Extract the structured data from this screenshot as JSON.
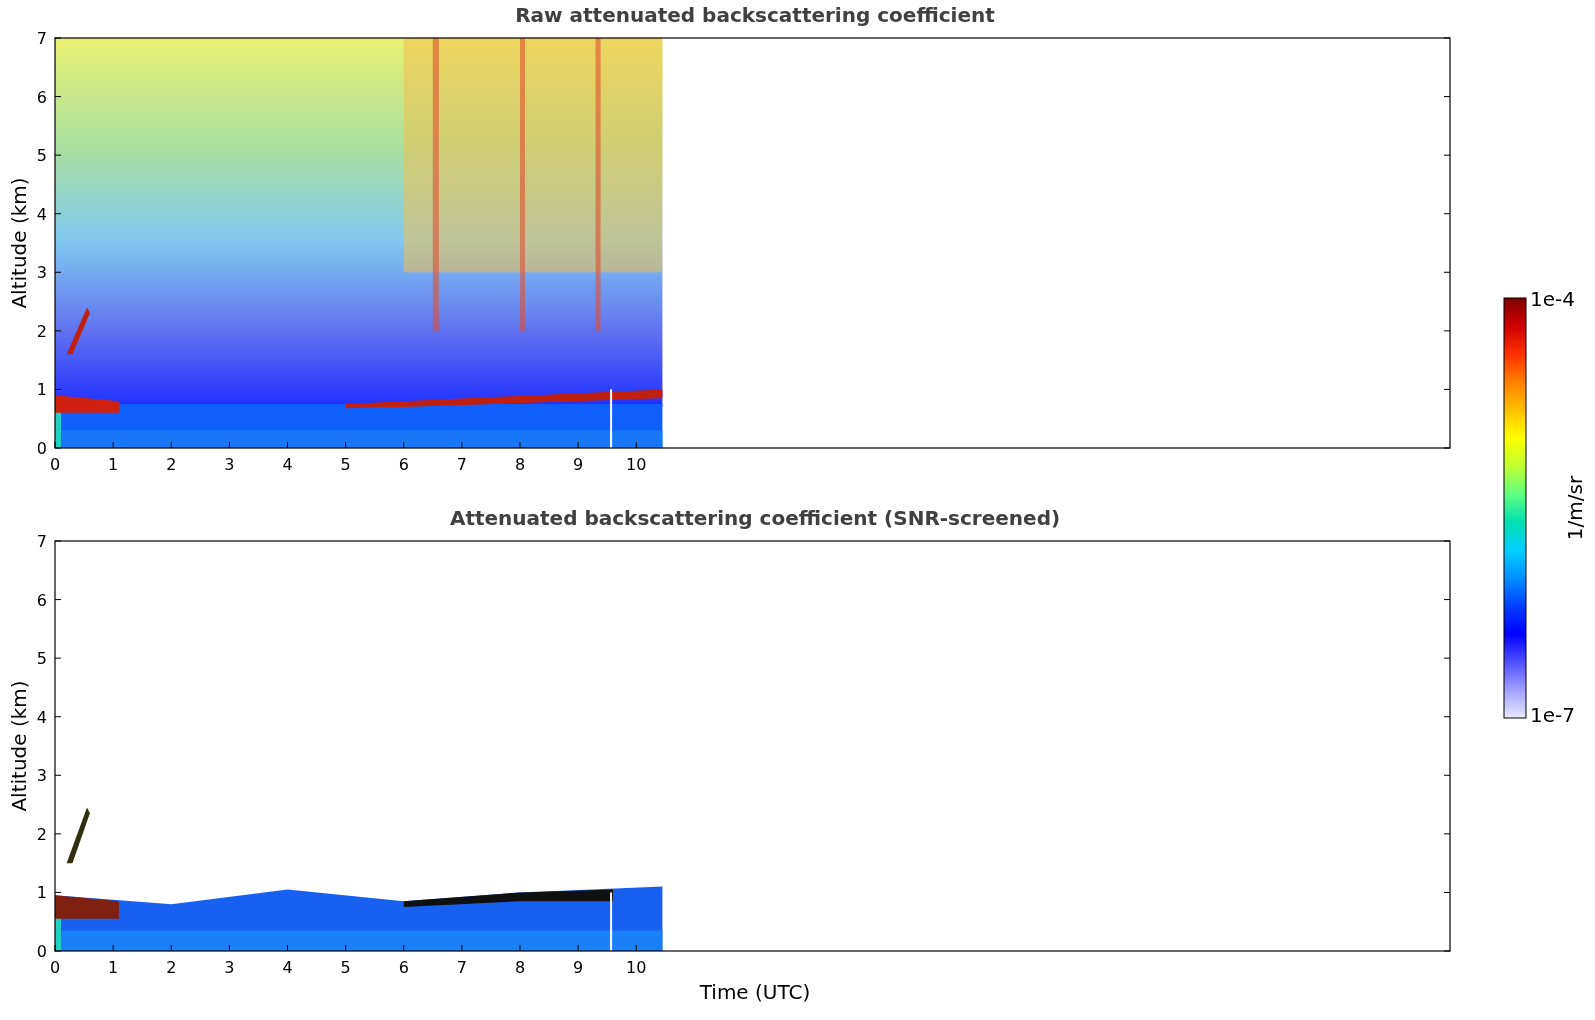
{
  "panels": [
    {
      "kind": "raw",
      "title": "Raw attenuated backscattering coefficient",
      "ylabel": "Altitude (km)",
      "yticks": [
        "7",
        "6",
        "5",
        "4",
        "3",
        "2",
        "1",
        "0"
      ],
      "xticks": [
        "0",
        "1",
        "2",
        "3",
        "4",
        "5",
        "6",
        "7",
        "8",
        "9",
        "10"
      ]
    },
    {
      "kind": "screened",
      "title": "Attenuated backscattering coefficient (SNR-screened)",
      "ylabel": "Altitude (km)",
      "yticks": [
        "7",
        "6",
        "5",
        "4",
        "3",
        "2",
        "1",
        "0"
      ],
      "xticks": [
        "0",
        "1",
        "2",
        "3",
        "4",
        "5",
        "6",
        "7",
        "8",
        "9",
        "10"
      ]
    }
  ],
  "xlabel": "Time (UTC)",
  "colorbar": {
    "max_label": "1e-4",
    "min_label": "1e-7",
    "unit": "1/m/sr"
  }
}
